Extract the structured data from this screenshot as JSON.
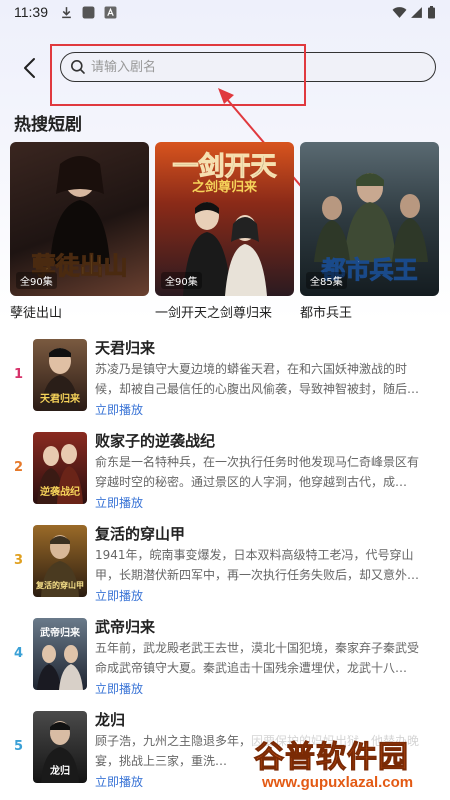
{
  "status_bar": {
    "time": "11:39"
  },
  "search": {
    "placeholder": "请输入剧名",
    "value": ""
  },
  "section": {
    "title": "热搜短剧"
  },
  "hot": [
    {
      "name": "孽徒出山",
      "poster_title": "孽徒出山",
      "episodes": "全90集",
      "colors": [
        "#2a1c18",
        "#7a4a35"
      ]
    },
    {
      "name": "一剑开天之剑尊归来",
      "poster_title": "一剑开天",
      "poster_subtitle": "之剑尊归来",
      "episodes": "全90集",
      "colors": [
        "#c24a1e",
        "#2b1d22"
      ]
    },
    {
      "name": "都市兵王",
      "poster_title": "都市兵王",
      "episodes": "全85集",
      "colors": [
        "#3a4a52",
        "#1a2228"
      ]
    }
  ],
  "list": [
    {
      "rank": "1",
      "rank_color": "#d6326a",
      "title": "天君归来",
      "desc": "苏凌乃是镇守大夏边境的蟒雀天君，在和六国妖神激战的时候，却被自己最信任的心腹出风偷袭，导致神智被封，随后…",
      "play": "立即播放",
      "thumb_text": "天君归来",
      "thumb_colors": [
        "#6a4a30",
        "#2a1a14"
      ]
    },
    {
      "rank": "2",
      "rank_color": "#e6792a",
      "title": "败家子的逆袭战纪",
      "desc": "俞东是一名特种兵，在一次执行任务时他发现马仁奇峰景区有穿越时空的秘密。通过景区的人字洞，他穿越到古代，成…",
      "play": "立即播放",
      "thumb_text": "逆袭战纪",
      "thumb_colors": [
        "#7a1e1e",
        "#2a0f0f"
      ]
    },
    {
      "rank": "3",
      "rank_color": "#e0a020",
      "title": "复活的穿山甲",
      "desc": "1941年，皖南事变爆发，日本双料高级特工老冯，代号穿山甲，长期潜伏新四军中，再一次执行任务失败后，却又意外…",
      "play": "立即播放",
      "thumb_text": "复活的穿山甲",
      "thumb_colors": [
        "#8a5a20",
        "#2a1c10"
      ]
    },
    {
      "rank": "4",
      "rank_color": "#3aa0d6",
      "title": "武帝归来",
      "desc": "五年前，武龙殿老武王去世，漠北十国犯境，秦家弃子秦武受命成武帝镇守大夏。秦武追击十国残余遭埋伏，龙武十八…",
      "play": "立即播放",
      "thumb_text": "武帝归来",
      "thumb_colors": [
        "#5a6a7a",
        "#1e2430"
      ]
    },
    {
      "rank": "5",
      "rank_color": "#3aa0d6",
      "title": "龙归",
      "desc": "顾子浩，九州之主隐退多年，因要保护的妈妈出狱，他替办晚宴，挑战上三家，重洗…",
      "play": "立即播放",
      "thumb_text": "龙归",
      "thumb_colors": [
        "#3a3a3a",
        "#141414"
      ]
    }
  ],
  "watermark": {
    "main": "谷普软件园",
    "url": "www.gupuxlazal.com"
  }
}
